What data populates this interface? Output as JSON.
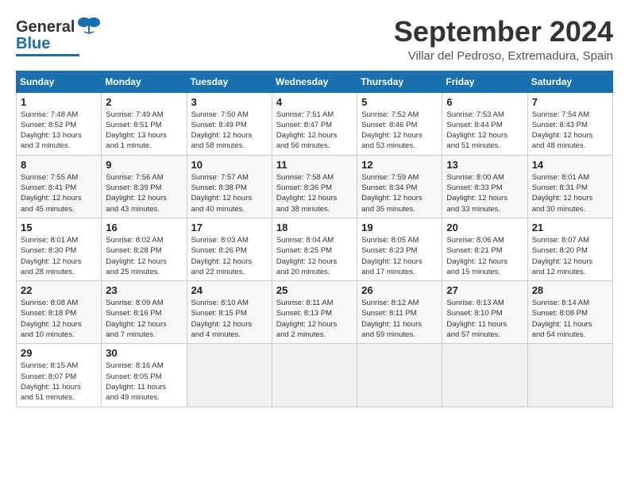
{
  "header": {
    "logo_general": "General",
    "logo_blue": "Blue",
    "month": "September 2024",
    "location": "Villar del Pedroso, Extremadura, Spain"
  },
  "weekdays": [
    "Sunday",
    "Monday",
    "Tuesday",
    "Wednesday",
    "Thursday",
    "Friday",
    "Saturday"
  ],
  "weeks": [
    [
      {
        "day": "1",
        "info": "Sunrise: 7:48 AM\nSunset: 8:52 PM\nDaylight: 13 hours\nand 3 minutes."
      },
      {
        "day": "2",
        "info": "Sunrise: 7:49 AM\nSunset: 8:51 PM\nDaylight: 13 hours\nand 1 minute."
      },
      {
        "day": "3",
        "info": "Sunrise: 7:50 AM\nSunset: 8:49 PM\nDaylight: 12 hours\nand 58 minutes."
      },
      {
        "day": "4",
        "info": "Sunrise: 7:51 AM\nSunset: 8:47 PM\nDaylight: 12 hours\nand 56 minutes."
      },
      {
        "day": "5",
        "info": "Sunrise: 7:52 AM\nSunset: 8:46 PM\nDaylight: 12 hours\nand 53 minutes."
      },
      {
        "day": "6",
        "info": "Sunrise: 7:53 AM\nSunset: 8:44 PM\nDaylight: 12 hours\nand 51 minutes."
      },
      {
        "day": "7",
        "info": "Sunrise: 7:54 AM\nSunset: 8:43 PM\nDaylight: 12 hours\nand 48 minutes."
      }
    ],
    [
      {
        "day": "8",
        "info": "Sunrise: 7:55 AM\nSunset: 8:41 PM\nDaylight: 12 hours\nand 45 minutes."
      },
      {
        "day": "9",
        "info": "Sunrise: 7:56 AM\nSunset: 8:39 PM\nDaylight: 12 hours\nand 43 minutes."
      },
      {
        "day": "10",
        "info": "Sunrise: 7:57 AM\nSunset: 8:38 PM\nDaylight: 12 hours\nand 40 minutes."
      },
      {
        "day": "11",
        "info": "Sunrise: 7:58 AM\nSunset: 8:36 PM\nDaylight: 12 hours\nand 38 minutes."
      },
      {
        "day": "12",
        "info": "Sunrise: 7:59 AM\nSunset: 8:34 PM\nDaylight: 12 hours\nand 35 minutes."
      },
      {
        "day": "13",
        "info": "Sunrise: 8:00 AM\nSunset: 8:33 PM\nDaylight: 12 hours\nand 33 minutes."
      },
      {
        "day": "14",
        "info": "Sunrise: 8:01 AM\nSunset: 8:31 PM\nDaylight: 12 hours\nand 30 minutes."
      }
    ],
    [
      {
        "day": "15",
        "info": "Sunrise: 8:01 AM\nSunset: 8:30 PM\nDaylight: 12 hours\nand 28 minutes."
      },
      {
        "day": "16",
        "info": "Sunrise: 8:02 AM\nSunset: 8:28 PM\nDaylight: 12 hours\nand 25 minutes."
      },
      {
        "day": "17",
        "info": "Sunrise: 8:03 AM\nSunset: 8:26 PM\nDaylight: 12 hours\nand 22 minutes."
      },
      {
        "day": "18",
        "info": "Sunrise: 8:04 AM\nSunset: 8:25 PM\nDaylight: 12 hours\nand 20 minutes."
      },
      {
        "day": "19",
        "info": "Sunrise: 8:05 AM\nSunset: 8:23 PM\nDaylight: 12 hours\nand 17 minutes."
      },
      {
        "day": "20",
        "info": "Sunrise: 8:06 AM\nSunset: 8:21 PM\nDaylight: 12 hours\nand 15 minutes."
      },
      {
        "day": "21",
        "info": "Sunrise: 8:07 AM\nSunset: 8:20 PM\nDaylight: 12 hours\nand 12 minutes."
      }
    ],
    [
      {
        "day": "22",
        "info": "Sunrise: 8:08 AM\nSunset: 8:18 PM\nDaylight: 12 hours\nand 10 minutes."
      },
      {
        "day": "23",
        "info": "Sunrise: 8:09 AM\nSunset: 8:16 PM\nDaylight: 12 hours\nand 7 minutes."
      },
      {
        "day": "24",
        "info": "Sunrise: 8:10 AM\nSunset: 8:15 PM\nDaylight: 12 hours\nand 4 minutes."
      },
      {
        "day": "25",
        "info": "Sunrise: 8:11 AM\nSunset: 8:13 PM\nDaylight: 12 hours\nand 2 minutes."
      },
      {
        "day": "26",
        "info": "Sunrise: 8:12 AM\nSunset: 8:11 PM\nDaylight: 11 hours\nand 59 minutes."
      },
      {
        "day": "27",
        "info": "Sunrise: 8:13 AM\nSunset: 8:10 PM\nDaylight: 11 hours\nand 57 minutes."
      },
      {
        "day": "28",
        "info": "Sunrise: 8:14 AM\nSunset: 8:08 PM\nDaylight: 11 hours\nand 54 minutes."
      }
    ],
    [
      {
        "day": "29",
        "info": "Sunrise: 8:15 AM\nSunset: 8:07 PM\nDaylight: 11 hours\nand 51 minutes."
      },
      {
        "day": "30",
        "info": "Sunrise: 8:16 AM\nSunset: 8:05 PM\nDaylight: 11 hours\nand 49 minutes."
      },
      {
        "day": "",
        "info": ""
      },
      {
        "day": "",
        "info": ""
      },
      {
        "day": "",
        "info": ""
      },
      {
        "day": "",
        "info": ""
      },
      {
        "day": "",
        "info": ""
      }
    ]
  ]
}
